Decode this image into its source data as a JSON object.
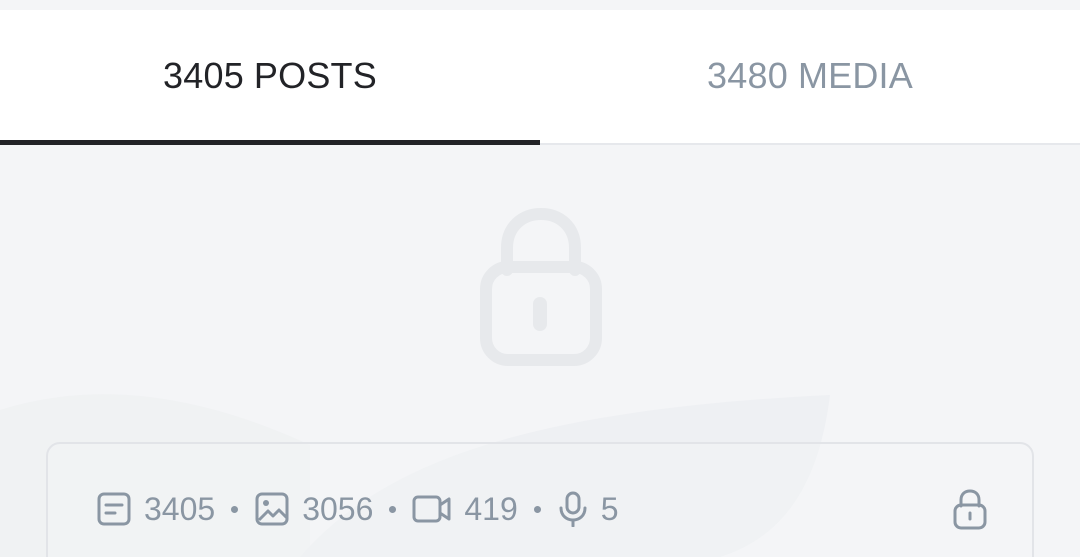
{
  "tabs": [
    {
      "count": "3405",
      "label": "POSTS",
      "active": true
    },
    {
      "count": "3480",
      "label": "MEDIA",
      "active": false
    }
  ],
  "locked_icon": "lock-icon",
  "stats": {
    "posts": {
      "icon": "text-post-icon",
      "value": "3405"
    },
    "photos": {
      "icon": "image-icon",
      "value": "3056"
    },
    "videos": {
      "icon": "video-icon",
      "value": "419"
    },
    "audio": {
      "icon": "microphone-icon",
      "value": "5"
    },
    "lock": {
      "icon": "lock-icon"
    }
  },
  "colors": {
    "active_tab_text": "#222327",
    "inactive_tab_text": "#8a96a3",
    "background": "#f4f5f7",
    "stats_text": "#8a96a3"
  }
}
